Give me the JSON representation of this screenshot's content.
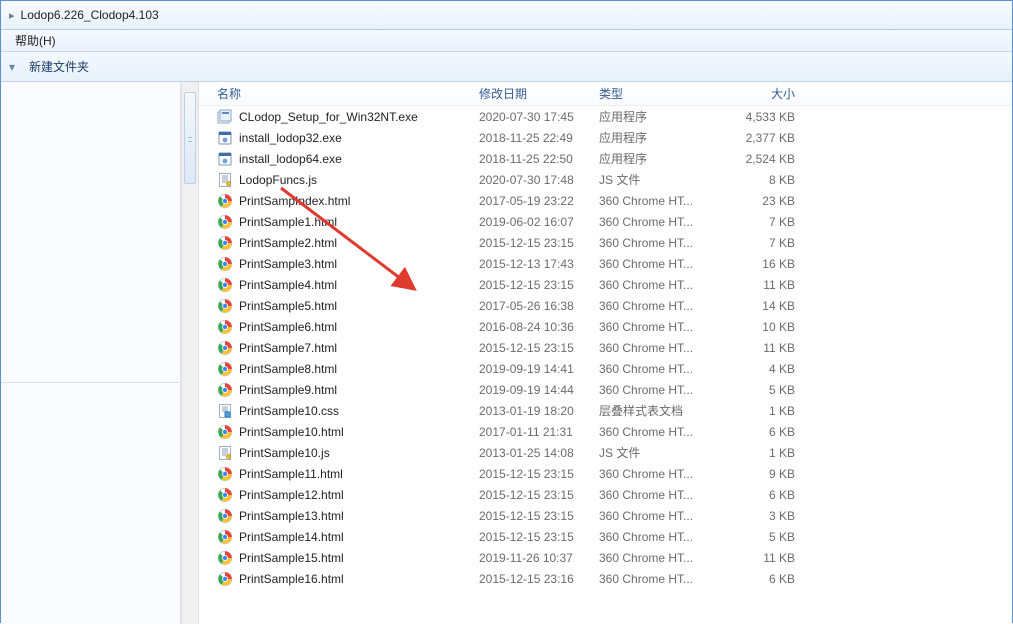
{
  "address": {
    "arrow": "▸",
    "path": "Lodop6.226_Clodop4.103"
  },
  "menu": {
    "help": "帮助(H)"
  },
  "toolbar": {
    "new_folder": "新建文件夹",
    "back_glyph": "▾"
  },
  "columns": {
    "name": "名称",
    "date": "修改日期",
    "type": "类型",
    "size": "大小"
  },
  "files": [
    {
      "icon": "installer",
      "name": "CLodop_Setup_for_Win32NT.exe",
      "date": "2020-07-30 17:45",
      "type": "应用程序",
      "size": "4,533 KB"
    },
    {
      "icon": "exe",
      "name": "install_lodop32.exe",
      "date": "2018-11-25 22:49",
      "type": "应用程序",
      "size": "2,377 KB"
    },
    {
      "icon": "exe",
      "name": "install_lodop64.exe",
      "date": "2018-11-25 22:50",
      "type": "应用程序",
      "size": "2,524 KB"
    },
    {
      "icon": "js",
      "name": "LodopFuncs.js",
      "date": "2020-07-30 17:48",
      "type": "JS 文件",
      "size": "8 KB"
    },
    {
      "icon": "chrome",
      "name": "PrintSampIndex.html",
      "date": "2017-05-19 23:22",
      "type": "360 Chrome HT...",
      "size": "23 KB"
    },
    {
      "icon": "chrome",
      "name": "PrintSample1.html",
      "date": "2019-06-02 16:07",
      "type": "360 Chrome HT...",
      "size": "7 KB"
    },
    {
      "icon": "chrome",
      "name": "PrintSample2.html",
      "date": "2015-12-15 23:15",
      "type": "360 Chrome HT...",
      "size": "7 KB"
    },
    {
      "icon": "chrome",
      "name": "PrintSample3.html",
      "date": "2015-12-13 17:43",
      "type": "360 Chrome HT...",
      "size": "16 KB"
    },
    {
      "icon": "chrome",
      "name": "PrintSample4.html",
      "date": "2015-12-15 23:15",
      "type": "360 Chrome HT...",
      "size": "11 KB"
    },
    {
      "icon": "chrome",
      "name": "PrintSample5.html",
      "date": "2017-05-26 16:38",
      "type": "360 Chrome HT...",
      "size": "14 KB"
    },
    {
      "icon": "chrome",
      "name": "PrintSample6.html",
      "date": "2016-08-24 10:36",
      "type": "360 Chrome HT...",
      "size": "10 KB"
    },
    {
      "icon": "chrome",
      "name": "PrintSample7.html",
      "date": "2015-12-15 23:15",
      "type": "360 Chrome HT...",
      "size": "11 KB"
    },
    {
      "icon": "chrome",
      "name": "PrintSample8.html",
      "date": "2019-09-19 14:41",
      "type": "360 Chrome HT...",
      "size": "4 KB"
    },
    {
      "icon": "chrome",
      "name": "PrintSample9.html",
      "date": "2019-09-19 14:44",
      "type": "360 Chrome HT...",
      "size": "5 KB"
    },
    {
      "icon": "css",
      "name": "PrintSample10.css",
      "date": "2013-01-19 18:20",
      "type": "层叠样式表文档",
      "size": "1 KB"
    },
    {
      "icon": "chrome",
      "name": "PrintSample10.html",
      "date": "2017-01-11 21:31",
      "type": "360 Chrome HT...",
      "size": "6 KB"
    },
    {
      "icon": "js",
      "name": "PrintSample10.js",
      "date": "2013-01-25 14:08",
      "type": "JS 文件",
      "size": "1 KB"
    },
    {
      "icon": "chrome",
      "name": "PrintSample11.html",
      "date": "2015-12-15 23:15",
      "type": "360 Chrome HT...",
      "size": "9 KB"
    },
    {
      "icon": "chrome",
      "name": "PrintSample12.html",
      "date": "2015-12-15 23:15",
      "type": "360 Chrome HT...",
      "size": "6 KB"
    },
    {
      "icon": "chrome",
      "name": "PrintSample13.html",
      "date": "2015-12-15 23:15",
      "type": "360 Chrome HT...",
      "size": "3 KB"
    },
    {
      "icon": "chrome",
      "name": "PrintSample14.html",
      "date": "2015-12-15 23:15",
      "type": "360 Chrome HT...",
      "size": "5 KB"
    },
    {
      "icon": "chrome",
      "name": "PrintSample15.html",
      "date": "2019-11-26 10:37",
      "type": "360 Chrome HT...",
      "size": "11 KB"
    },
    {
      "icon": "chrome",
      "name": "PrintSample16.html",
      "date": "2015-12-15 23:16",
      "type": "360 Chrome HT...",
      "size": "6 KB"
    }
  ]
}
